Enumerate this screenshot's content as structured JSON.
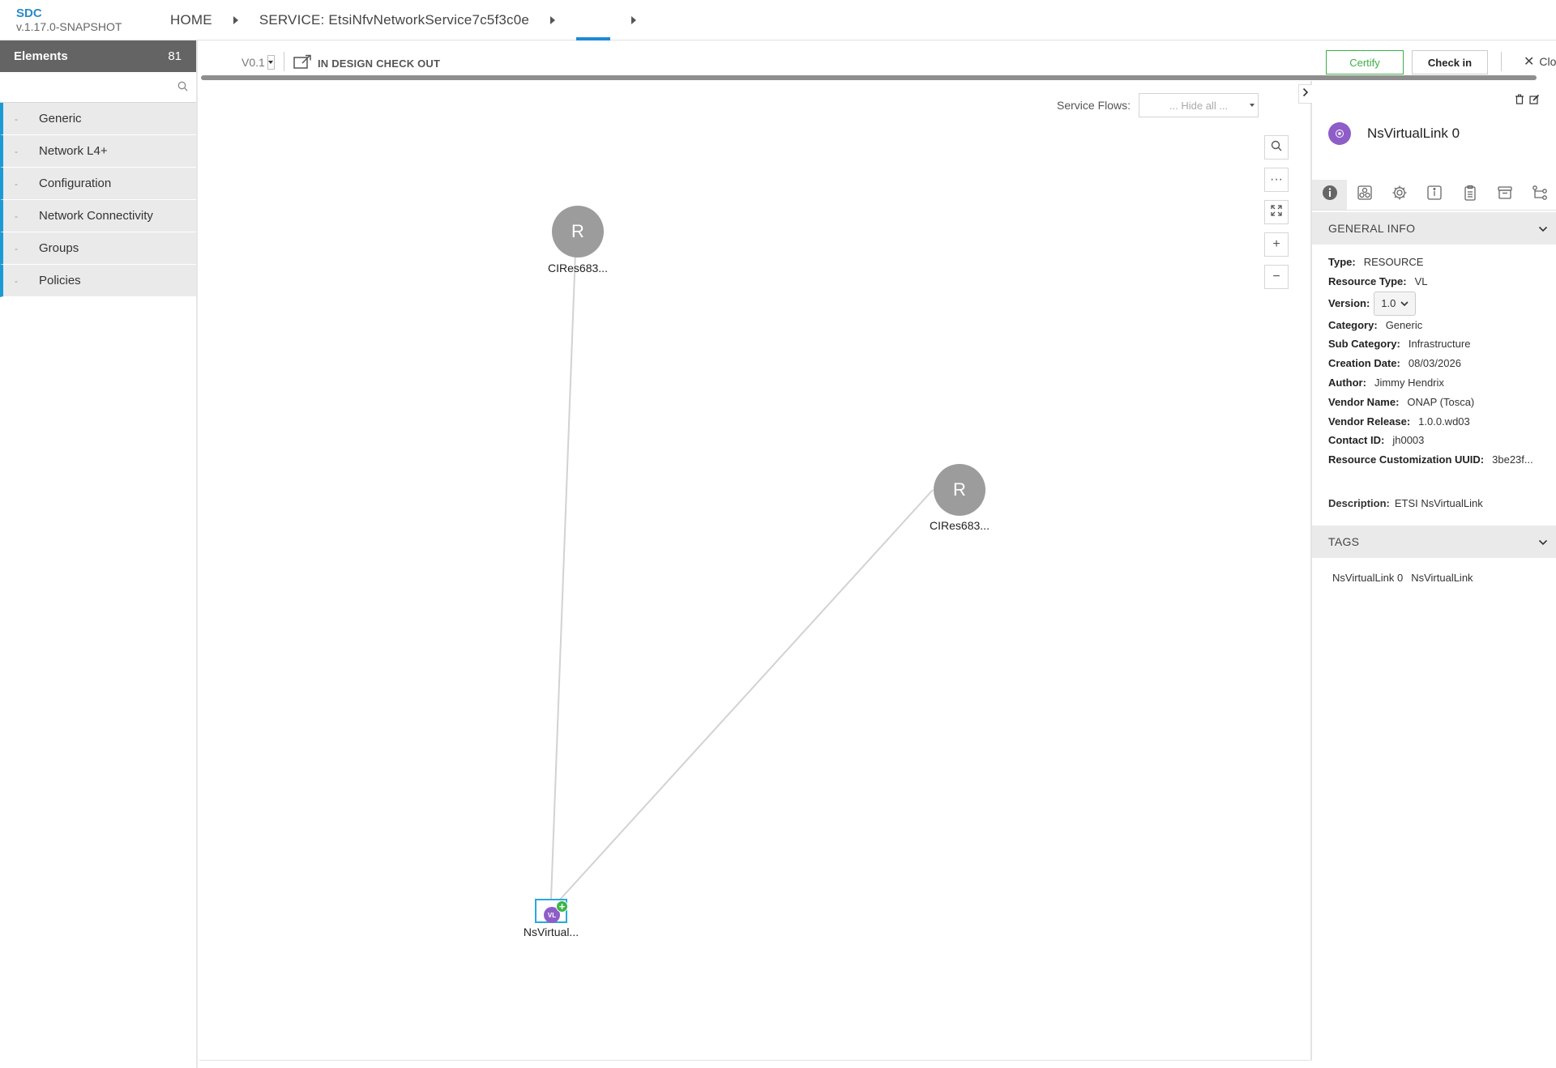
{
  "app": {
    "name": "SDC",
    "version": "v.1.17.0-SNAPSHOT"
  },
  "breadcrumb": {
    "home": "HOME",
    "service": "SERVICE: EtsiNfvNetworkService7c5f3c0e"
  },
  "palette": {
    "title": "Elements",
    "count": "81",
    "search_placeholder": "",
    "categories": [
      {
        "label": "Generic"
      },
      {
        "label": "Network L4+"
      },
      {
        "label": "Configuration"
      },
      {
        "label": "Network Connectivity"
      },
      {
        "label": "Groups"
      },
      {
        "label": "Policies"
      }
    ]
  },
  "toolbar": {
    "version": "V0.1",
    "status": "IN DESIGN CHECK OUT",
    "certify_label": "Certify",
    "checkin_label": "Check in",
    "close_label": "Clo"
  },
  "canvas": {
    "service_flows_label": "Service Flows:",
    "service_flows_value": "... Hide all ...",
    "nodes": [
      {
        "letter": "R",
        "label": "CIRes683..."
      },
      {
        "letter": "R",
        "label": "CIRes683..."
      },
      {
        "icon_text": "VL",
        "label": "NsVirtual..."
      }
    ]
  },
  "details": {
    "title": "NsVirtualLink 0",
    "general_info_heading": "GENERAL INFO",
    "fields": {
      "type_label": "Type:",
      "type": "RESOURCE",
      "resource_type_label": "Resource Type:",
      "resource_type": "VL",
      "version_label": "Version:",
      "version": "1.0",
      "category_label": "Category:",
      "category": "Generic",
      "sub_category_label": "Sub Category:",
      "sub_category": "Infrastructure",
      "creation_date_label": "Creation Date:",
      "creation_date": "08/03/2026",
      "author_label": "Author:",
      "author": "Jimmy Hendrix",
      "vendor_name_label": "Vendor Name:",
      "vendor_name": "ONAP (Tosca)",
      "vendor_release_label": "Vendor Release:",
      "vendor_release": "1.0.0.wd03",
      "contact_id_label": "Contact ID:",
      "contact_id": "jh0003",
      "uuid_label": "Resource Customization UUID:",
      "uuid": "3be23f...",
      "description_label": "Description:",
      "description": "ETSI NsVirtualLink"
    },
    "tags_heading": "TAGS",
    "tags": [
      "NsVirtualLink 0",
      "NsVirtualLink"
    ]
  },
  "colors": {
    "accent": "#1c9ad6",
    "certify": "#3cb048",
    "vl_node": "#8e5dc8",
    "resource_node": "#9c9c9c",
    "header_bar": "#646464"
  }
}
